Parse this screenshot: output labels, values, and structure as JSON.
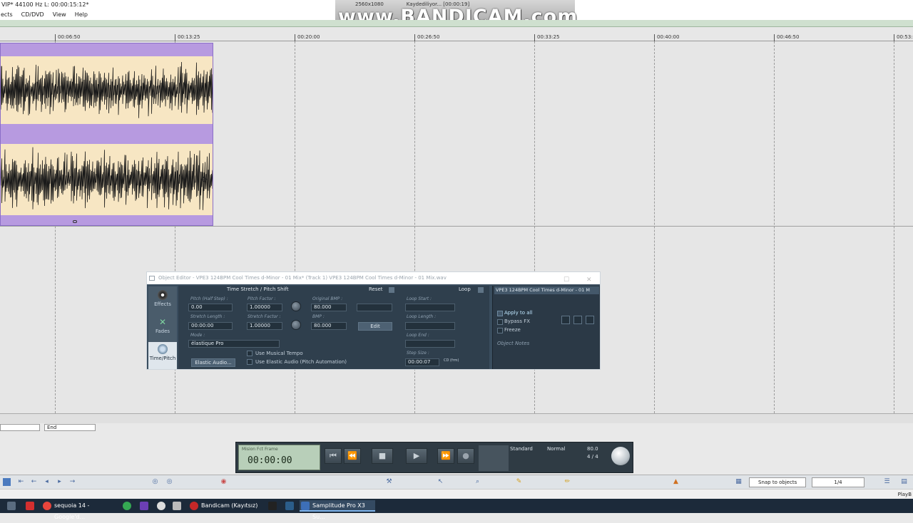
{
  "app": {
    "title": "VIP*  44100 Hz L: 00:00:15:12*",
    "menu": [
      "ects",
      "CD/DVD",
      "View",
      "Help"
    ]
  },
  "bandicam": {
    "resolution": "2560x1080",
    "status": "Kaydediliyor... [00:00:19]",
    "logo": "www.BANDICAM.com"
  },
  "ruler": {
    "labels": [
      "00:06:50",
      "00:13:25",
      "00:20:00",
      "00:26:50",
      "00:33:25",
      "00:40:00",
      "00:46:50",
      "00:53:25"
    ]
  },
  "object_editor": {
    "title": "Object Editor - VPE3 124BPM Cool Times d-Minor - 01 Mix* (Track 1)   VPE3 124BPM Cool Times d-Minor - 01 Mix.wav",
    "tabs": [
      {
        "label": "Effects",
        "icon": "effects-knob-icon"
      },
      {
        "label": "Fades",
        "icon": "fades-icon"
      },
      {
        "label": "Time/Pitch",
        "icon": "timepitch-icon"
      }
    ],
    "panel_title": "Time Stretch / Pitch Shift",
    "reset_label": "Reset",
    "loop_label": "Loop",
    "pitch_half_step_label": "Pitch (Half Step) :",
    "pitch_half_step_value": "0.00",
    "pitch_factor_label": "Pitch Factor :",
    "pitch_factor_value": "1.00000",
    "original_bmp_label": "Original BMP :",
    "original_bmp_value": "80.000",
    "stretch_length_label": "Stretch Length :",
    "stretch_length_value": "00:00:00",
    "stretch_factor_label": "Stretch Factor :",
    "stretch_factor_value": "1.00000",
    "bmp_label": "BMP :",
    "bmp_value": "80.000",
    "edit_label": "Edit",
    "mode_label": "Mode :",
    "mode_value": "élastique Pro",
    "use_musical_tempo": "Use Musical Tempo",
    "use_elastic_audio": "Use Elastic Audio (Pitch Automation)",
    "elastic_audio_button": "Elastic Audio...",
    "loop_start_label": "Loop Start :",
    "loop_length_label": "Loop Length :",
    "loop_end_label": "Loop End :",
    "step_size_label": "Step Size :",
    "step_size_value": "00:00:07",
    "step_unit": "CD (frm)",
    "object_name": "VPE3 124BPM Cool Times d-Minor - 01 M",
    "apply_to_all": "Apply to all",
    "bypass_fx": "Bypass FX",
    "freeze": "Freeze",
    "object_notes": "Object Notes"
  },
  "transport": {
    "time": "00:00:00",
    "mode_labels": "Mision  Fct  Frame",
    "standard_label": "Standard",
    "normal_label": "Normal",
    "bpm_value": "80.0",
    "signature": "4 / 4",
    "buttons": [
      "rewind-start",
      "rewind",
      "stop",
      "play",
      "fast-forward",
      "record"
    ]
  },
  "toolbar": {
    "snap": "Snap to objects",
    "page": "1/4"
  },
  "bottom": {
    "end_label": "End"
  },
  "statusbar": {
    "right": "PlayB"
  },
  "taskbar": {
    "items": [
      {
        "label": "sequoia 14 - Google'd...",
        "color": "#e8453c"
      },
      {
        "label": "Bandicam (Kayıtsız)",
        "color": "#c62828"
      },
      {
        "label": "Samplitude Pro X3 Su...",
        "color": "#3d6fb8"
      }
    ]
  },
  "colors": {
    "clip_bg": "#b79ae0",
    "wave_bg": "#f7e6c3",
    "editor_bg": "#3a4d5e"
  }
}
